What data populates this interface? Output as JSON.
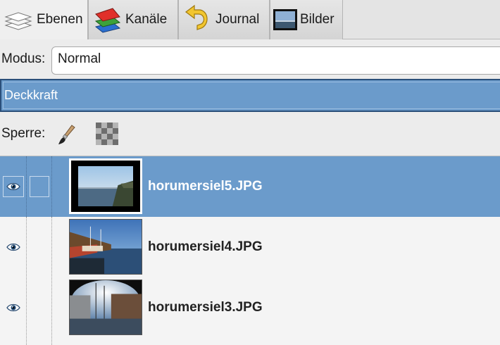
{
  "tabs": [
    {
      "label": "Ebenen",
      "icon": "layers-icon",
      "active": true
    },
    {
      "label": "Kanäle",
      "icon": "channels-icon",
      "active": false
    },
    {
      "label": "Journal",
      "icon": "undo-history-icon",
      "active": false
    },
    {
      "label": "Bilder",
      "icon": "images-icon",
      "active": false
    }
  ],
  "mode": {
    "label": "Modus:",
    "value": "Normal"
  },
  "opacity": {
    "label": "Deckkraft"
  },
  "lock": {
    "label": "Sperre:",
    "icons": [
      "lock-pixels-brush-icon",
      "lock-alpha-icon"
    ]
  },
  "layers": [
    {
      "name": "horumersiel5.JPG",
      "visible": true,
      "selected": true
    },
    {
      "name": "horumersiel4.JPG",
      "visible": true,
      "selected": false
    },
    {
      "name": "horumersiel3.JPG",
      "visible": true,
      "selected": false
    }
  ],
  "colors": {
    "selection": "#6b9bcb",
    "selection_border": "#2b4f7a",
    "background": "#ececec"
  }
}
